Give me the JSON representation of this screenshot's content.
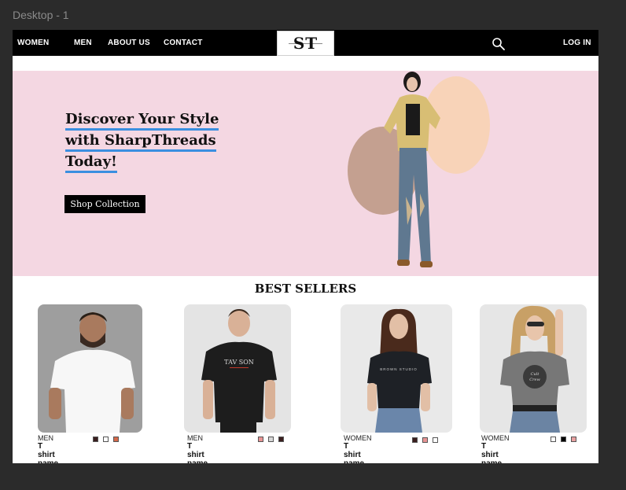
{
  "frame": {
    "label": "Desktop - 1"
  },
  "nav": {
    "links": [
      "WOMEN",
      "MEN",
      "ABOUT US",
      "CONTACT"
    ],
    "logo": "ST",
    "login": "LOG IN"
  },
  "hero": {
    "title_lines": [
      "Discover Your Style",
      "with SharpThreads",
      "Today!"
    ],
    "cta": "Shop Collection"
  },
  "best_sellers": {
    "title": "BEST SELLERS",
    "products": [
      {
        "category": "MEN",
        "name": "T shirt name",
        "swatches": [
          "#3a1e1e",
          "#ffffff",
          "#d4694a"
        ]
      },
      {
        "category": "MEN",
        "name": "T shirt name",
        "swatches": [
          "#e89494",
          "#d8d8d8",
          "#3a1e1e"
        ]
      },
      {
        "category": "WOMEN",
        "name": "T shirt name",
        "swatches": [
          "#3a1e1e",
          "#e89494",
          "#ffffff"
        ]
      },
      {
        "category": "WOMEN",
        "name": "T shirt name",
        "swatches": [
          "#ffffff",
          "#000000",
          "#e8a0a0"
        ]
      }
    ]
  },
  "colors": {
    "nav_bg": "#000000",
    "hero_bg": "#f4d7e2",
    "underline": "#3a8fe0"
  }
}
